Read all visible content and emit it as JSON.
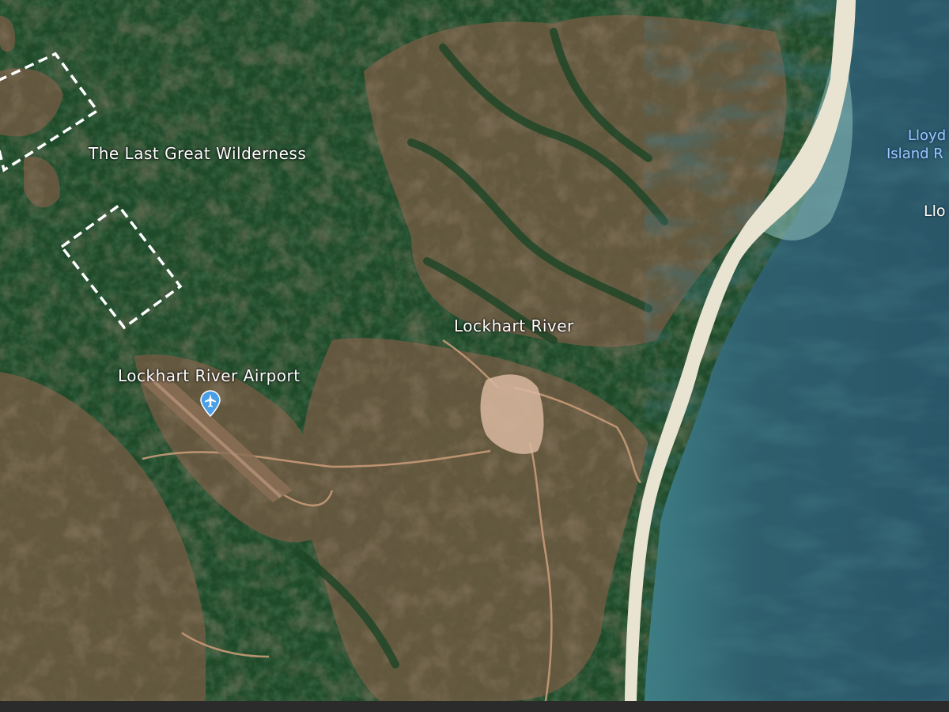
{
  "map": {
    "imagery": "satellite",
    "labels": {
      "wilderness": "The Last Great Wilderness",
      "town": "Lockhart River",
      "airport": "Lockhart River Airport",
      "island_line1": "Lloyd",
      "island_line2": "Island R",
      "island_small": "Llo"
    },
    "icons": {
      "airport": "airport-plane-icon"
    },
    "colors": {
      "forest": "#1f4a2a",
      "clearing": "#6e5a42",
      "sand": "#e9e4d2",
      "sea": "#2f5f6c",
      "shallow": "#8fc1bd",
      "road": "#c89a78",
      "airport_pin": "#4a9fe6",
      "island_label": "#9fc6ff"
    },
    "overlays": [
      {
        "type": "dashed-rectangle",
        "color": "#ffffff"
      },
      {
        "type": "dashed-rectangle",
        "color": "#ffffff"
      }
    ]
  }
}
